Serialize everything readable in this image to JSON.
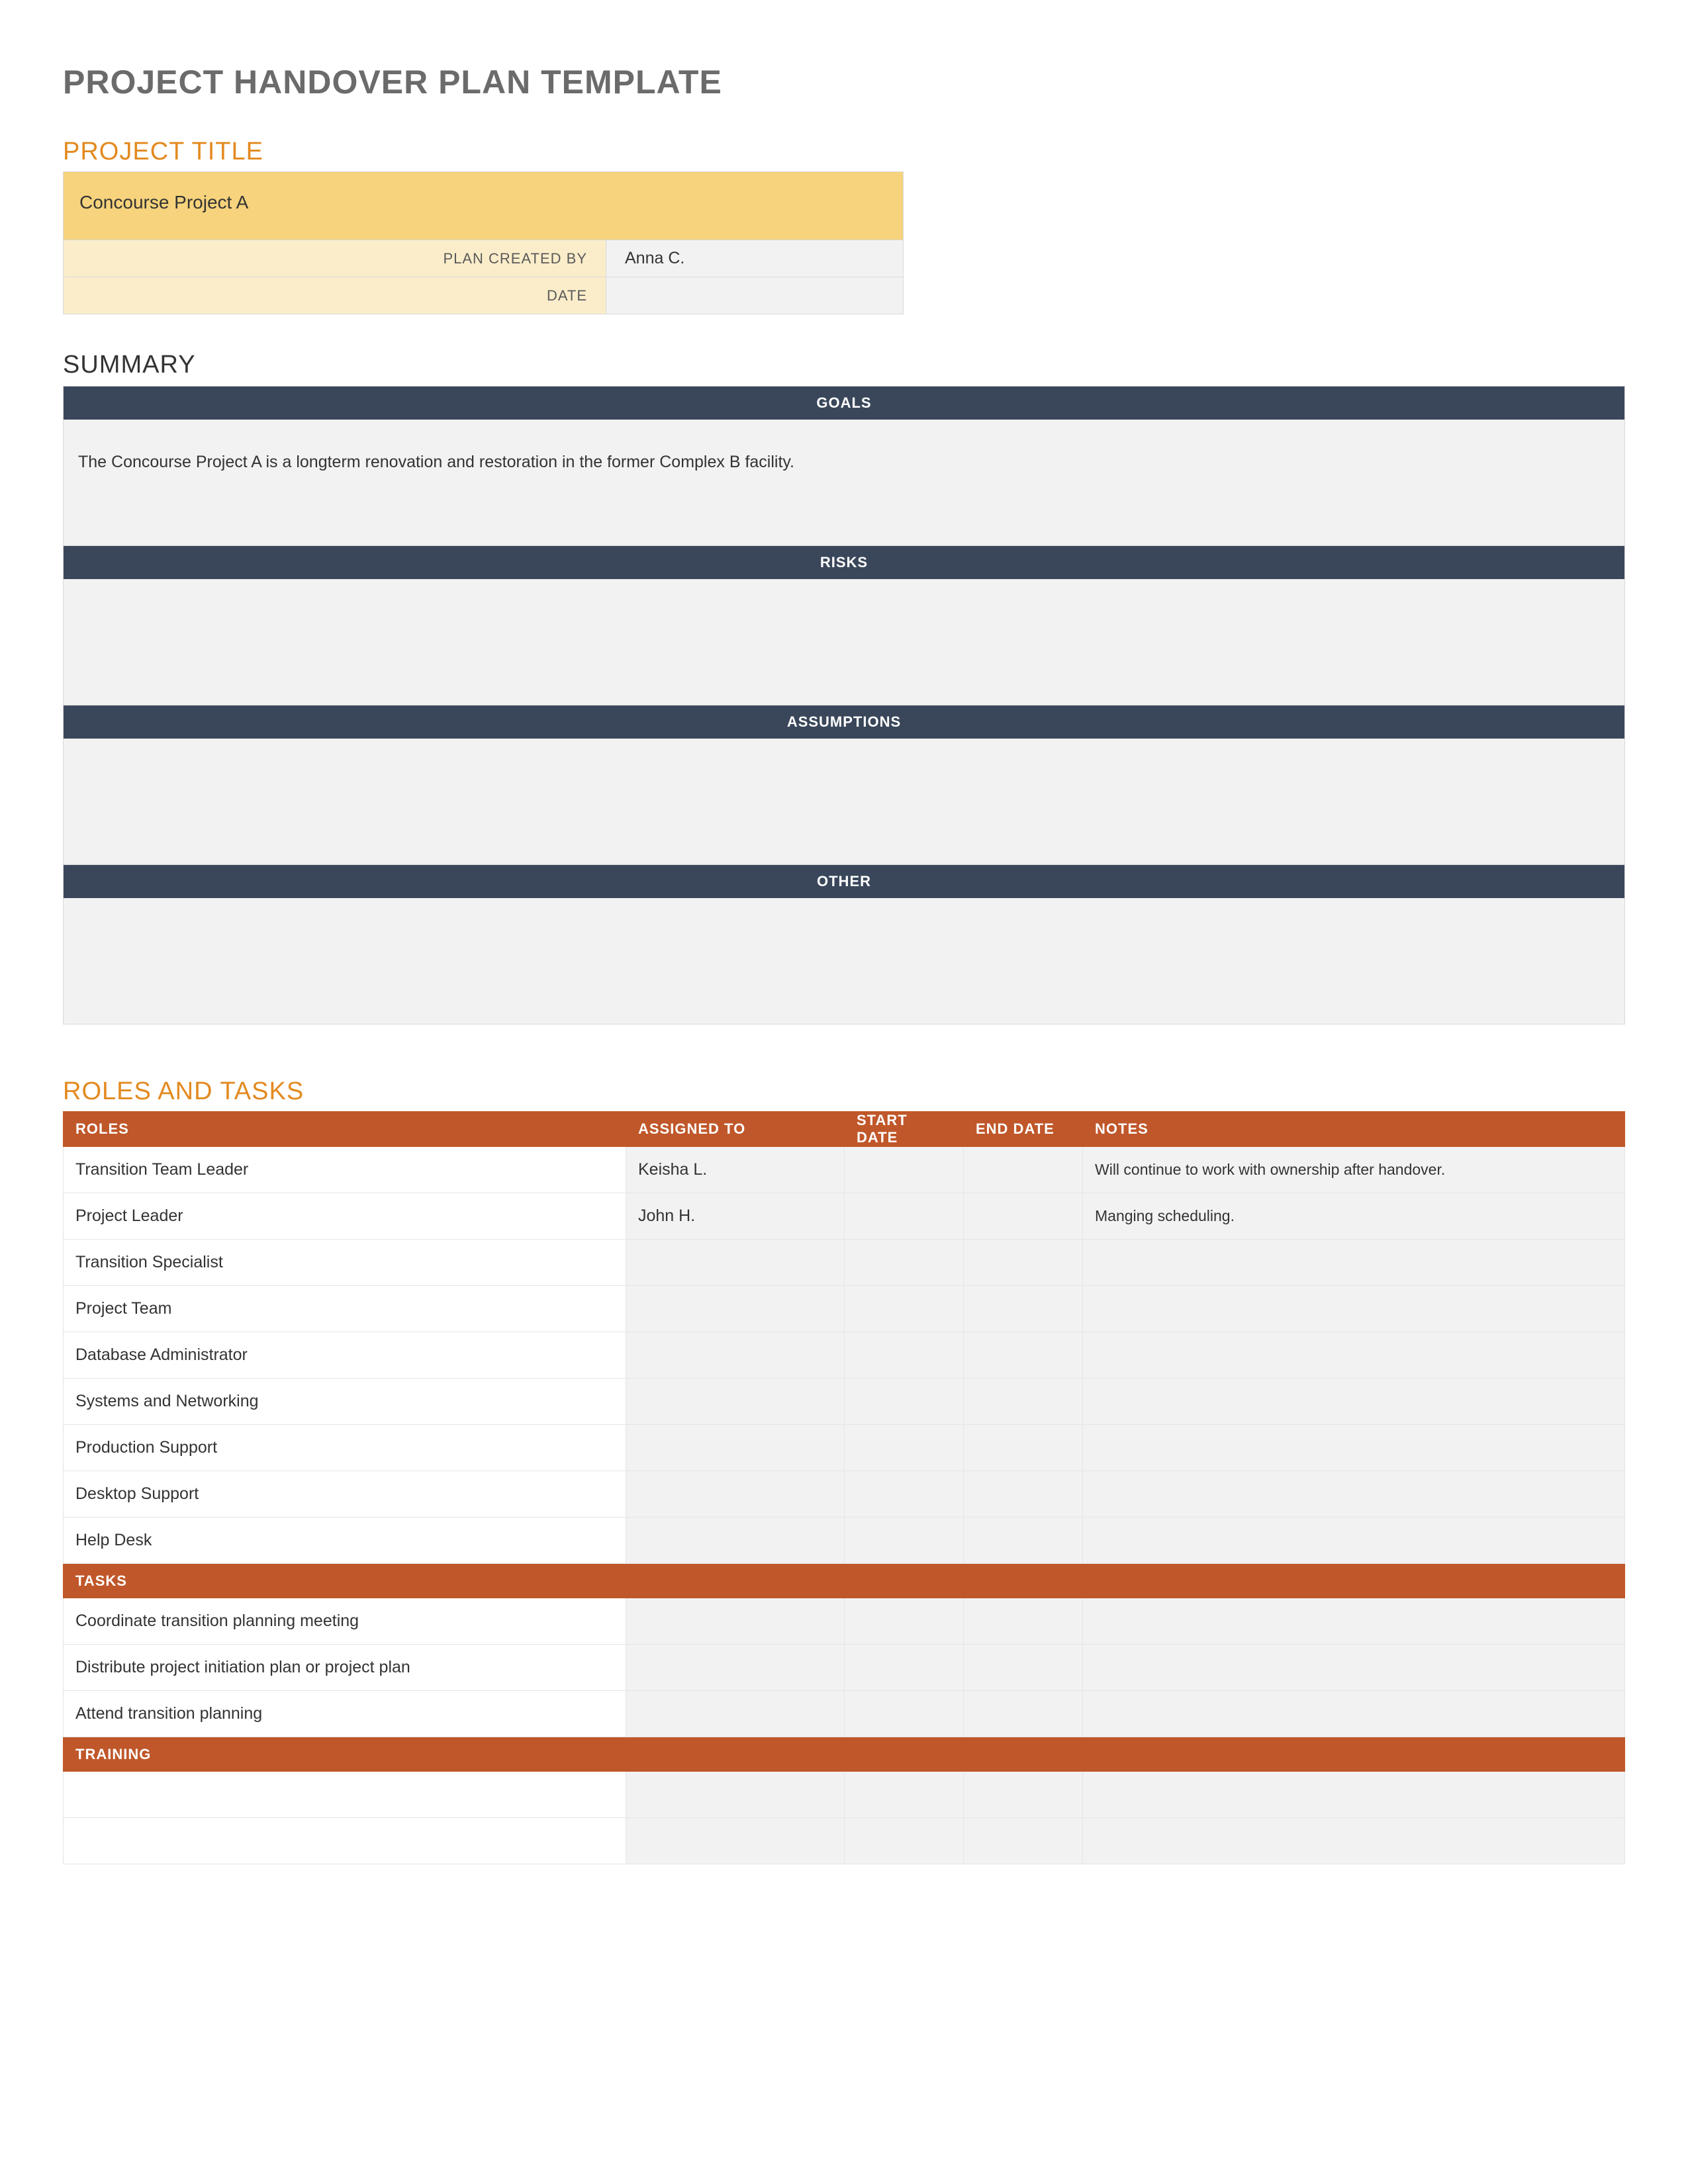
{
  "doc_title": "PROJECT HANDOVER PLAN TEMPLATE",
  "project_title_heading": "PROJECT TITLE",
  "project_name": "Concourse Project A",
  "plan_created_by_label": "PLAN CREATED BY",
  "plan_created_by_value": "Anna C.",
  "date_label": "DATE",
  "date_value": "",
  "summary_heading": "SUMMARY",
  "summary": {
    "goals_label": "GOALS",
    "goals_text": "The Concourse Project A is a longterm renovation and restoration in the former Complex B facility.",
    "risks_label": "RISKS",
    "risks_text": "",
    "assumptions_label": "ASSUMPTIONS",
    "assumptions_text": "",
    "other_label": "OTHER",
    "other_text": ""
  },
  "roles_heading": "ROLES AND TASKS",
  "columns": {
    "roles": "ROLES",
    "assigned": "ASSIGNED TO",
    "start": "START DATE",
    "end": "END DATE",
    "notes": "NOTES"
  },
  "roles_rows": [
    {
      "role": "Transition Team Leader",
      "assigned": "Keisha L.",
      "start": "",
      "end": "",
      "notes": "Will continue to work with ownership after handover."
    },
    {
      "role": "Project Leader",
      "assigned": "John H.",
      "start": "",
      "end": "",
      "notes": "Manging scheduling."
    },
    {
      "role": "Transition Specialist",
      "assigned": "",
      "start": "",
      "end": "",
      "notes": ""
    },
    {
      "role": "Project Team",
      "assigned": "",
      "start": "",
      "end": "",
      "notes": ""
    },
    {
      "role": "Database Administrator",
      "assigned": "",
      "start": "",
      "end": "",
      "notes": ""
    },
    {
      "role": "Systems and Networking",
      "assigned": "",
      "start": "",
      "end": "",
      "notes": ""
    },
    {
      "role": "Production Support",
      "assigned": "",
      "start": "",
      "end": "",
      "notes": ""
    },
    {
      "role": "Desktop Support",
      "assigned": "",
      "start": "",
      "end": "",
      "notes": ""
    },
    {
      "role": "Help Desk",
      "assigned": "",
      "start": "",
      "end": "",
      "notes": ""
    }
  ],
  "tasks_section_label": "TASKS",
  "tasks_rows": [
    {
      "role": "Coordinate transition planning meeting",
      "assigned": "",
      "start": "",
      "end": "",
      "notes": ""
    },
    {
      "role": "Distribute project initiation plan or project plan",
      "assigned": "",
      "start": "",
      "end": "",
      "notes": ""
    },
    {
      "role": "Attend transition planning",
      "assigned": "",
      "start": "",
      "end": "",
      "notes": ""
    }
  ],
  "training_section_label": "TRAINING",
  "training_rows": [
    {
      "role": "",
      "assigned": "",
      "start": "",
      "end": "",
      "notes": ""
    },
    {
      "role": "",
      "assigned": "",
      "start": "",
      "end": "",
      "notes": ""
    }
  ]
}
